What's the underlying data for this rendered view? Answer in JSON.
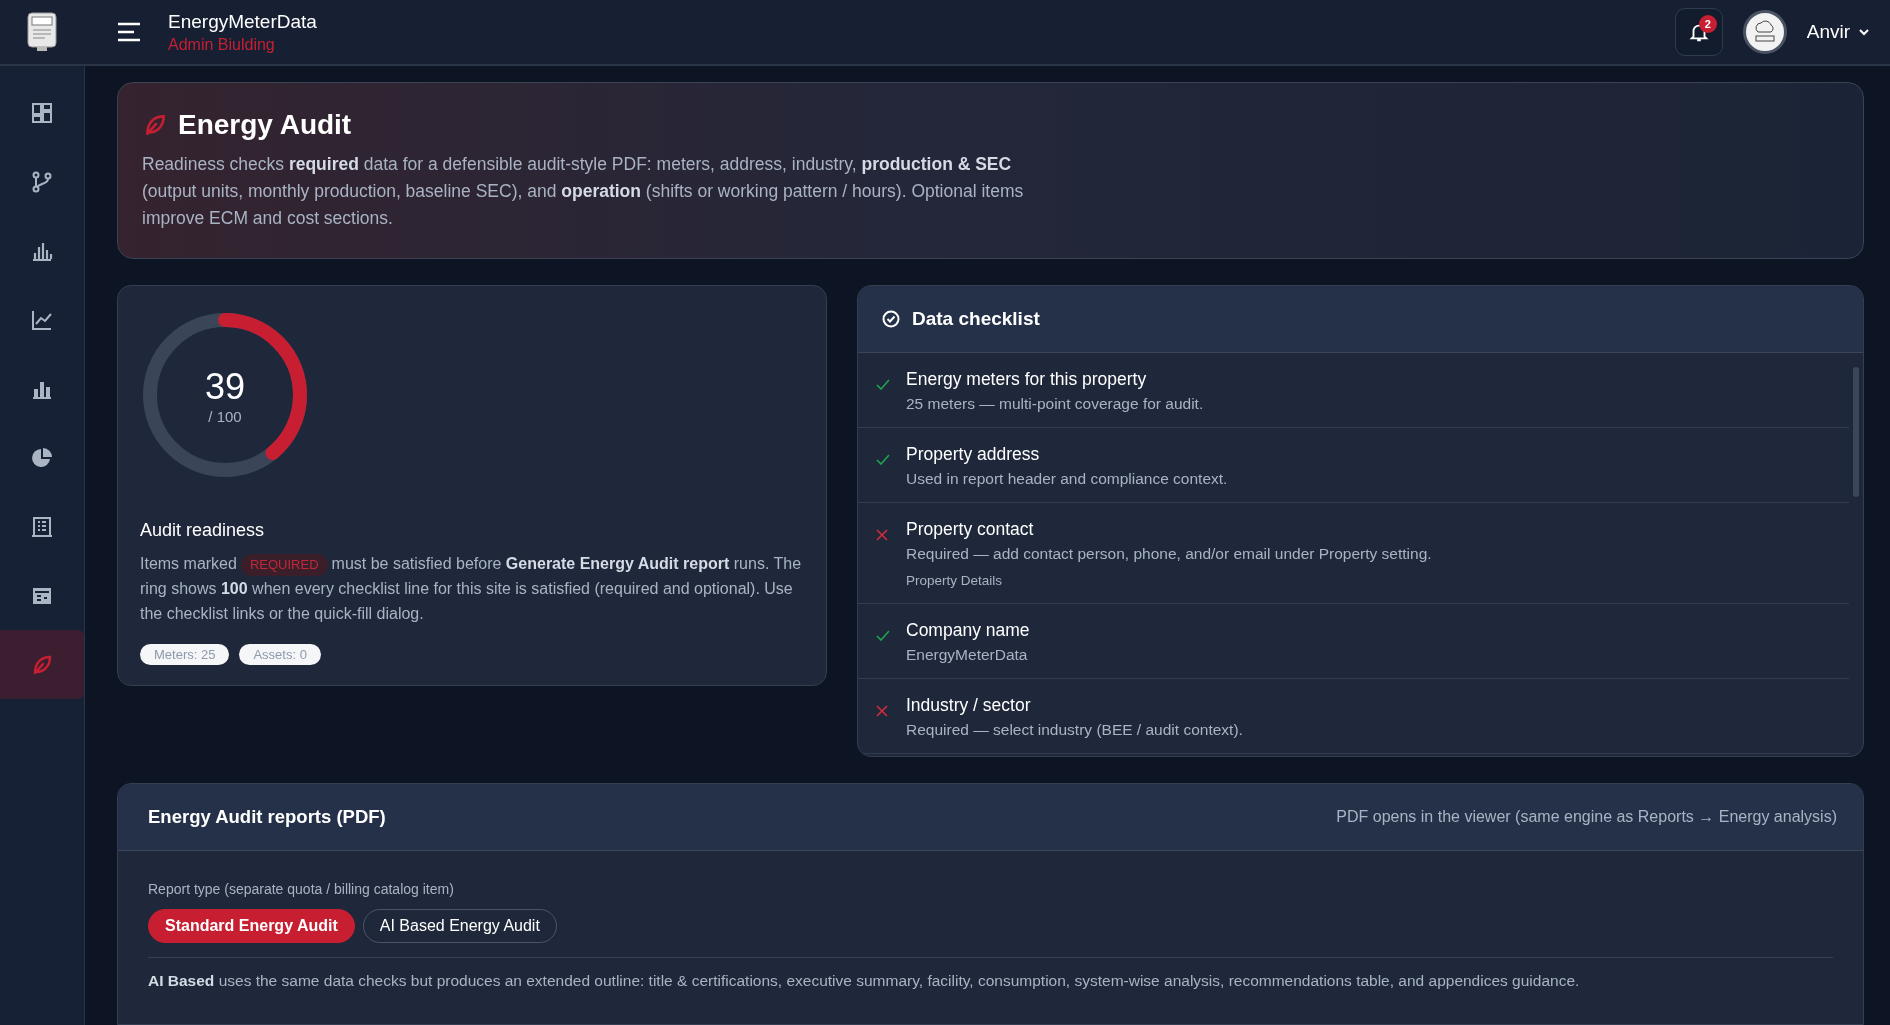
{
  "topbar": {
    "app_name": "EnergyMeterData",
    "subtitle": "Admin Biulding",
    "notifications": "2",
    "user": "Anvir"
  },
  "sidebar": {
    "items": [
      {
        "selected": false
      },
      {
        "selected": false
      },
      {
        "selected": false
      },
      {
        "selected": false
      },
      {
        "selected": false
      },
      {
        "selected": false
      },
      {
        "selected": false
      },
      {
        "selected": false
      },
      {
        "selected": true
      }
    ]
  },
  "hero": {
    "title": "Energy Audit",
    "description": "Readiness checks **required** data for a defensible audit-style PDF: meters, address, industry, **production & SEC** (output units, monthly production, baseline SEC), and **operation** (shifts or working pattern / hours). Optional items improve ECM and cost sections."
  },
  "readiness": {
    "score": "39",
    "out_of": "/ 100",
    "level": 0.39,
    "title": "Audit readiness",
    "text_before": "Items marked",
    "badge": "REQUIRED",
    "text_after": "must be satisfied before **Generate Energy Audit report** runs. The ring shows **100** when every checklist line for this site is satisfied (required and optional). Use the checklist links or the quick-fill dialog.",
    "pills": [
      "Meters: 25",
      "Assets: 0"
    ]
  },
  "checklist": {
    "title": "Data checklist",
    "items": [
      {
        "title": "Energy meters for this property",
        "detail": "25 meters — multi-point coverage for audit.",
        "done": true
      },
      {
        "title": "Property address",
        "detail": "Used in report header and compliance context.",
        "done": true
      },
      {
        "title": "Property contact",
        "detail": "Required — add contact person, phone, and/or email under Property setting.",
        "link": "Property Details",
        "done": false
      },
      {
        "title": "Company name",
        "detail": "EnergyMeterData",
        "done": true
      },
      {
        "title": "Industry / sector",
        "detail": "Required — select industry (BEE / audit context).",
        "done": false
      }
    ]
  },
  "reports": {
    "title": "Energy Audit reports (PDF)",
    "note": "PDF opens in the viewer (same engine as Reports → Energy analysis)",
    "type_label": "Report type (separate quota / billing catalog item)",
    "types": [
      {
        "label": "Standard Energy Audit",
        "selected": true
      },
      {
        "label": "AI Based Energy Audit",
        "selected": false
      }
    ],
    "description": "**AI Based** uses the same data checks but produces an extended outline: title & certifications, executive summary, facility, consumption, system-wise analysis, recommendations table, and appendices guidance."
  }
}
